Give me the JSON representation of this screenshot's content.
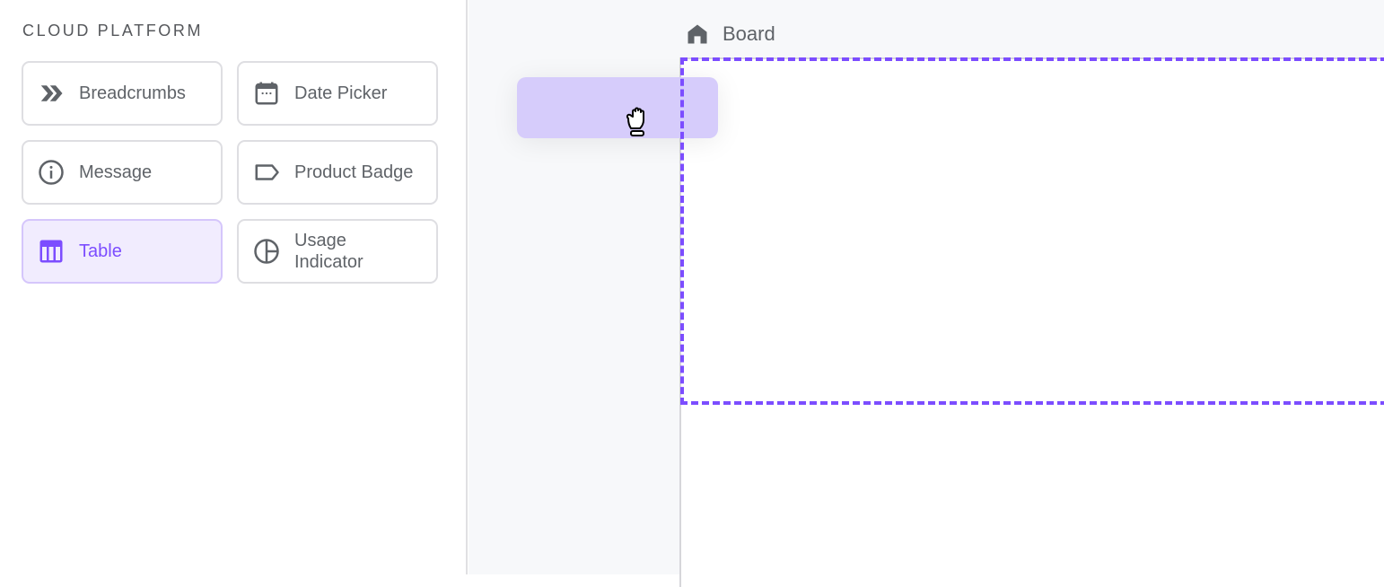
{
  "sidebar": {
    "section_title": "CLOUD PLATFORM",
    "items": [
      {
        "label": "Breadcrumbs",
        "icon": "double-chevron-icon",
        "active": false
      },
      {
        "label": "Date Picker",
        "icon": "calendar-icon",
        "active": false
      },
      {
        "label": "Message",
        "icon": "info-icon",
        "active": false
      },
      {
        "label": "Product Badge",
        "icon": "tag-icon",
        "active": false
      },
      {
        "label": "Table",
        "icon": "table-icon",
        "active": true
      },
      {
        "label": "Usage Indicator",
        "icon": "pie-chart-icon",
        "active": false
      }
    ]
  },
  "board": {
    "title": "Board",
    "icon": "home-icon"
  },
  "colors": {
    "accent": "#7c4dff",
    "active_bg": "#f1ecfe",
    "ghost": "#d6ccfb"
  }
}
